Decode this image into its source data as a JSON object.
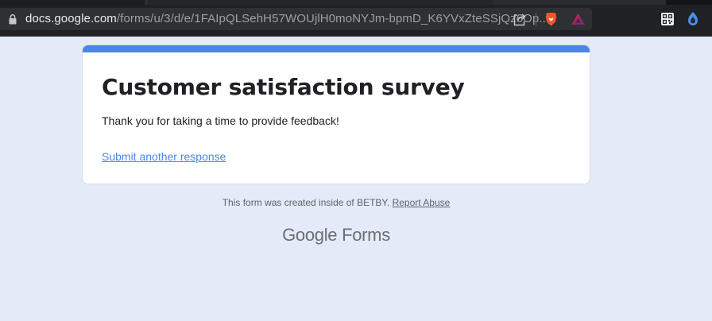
{
  "browser": {
    "url_host": "docs.google.com",
    "url_path": "/forms/u/3/d/e/1FAIpQLSehH57WOUjlH0moNYJm-bpmD_K6YVxZteSSjQz6Op..."
  },
  "form": {
    "title": "Customer satisfaction survey",
    "confirmation_message": "Thank you for taking a time to provide feedback!",
    "submit_another_label": "Submit another response",
    "accent_color": "#4a86e8",
    "background_color": "#e3ebf9"
  },
  "footer": {
    "created_text": "This form was created inside of BETBY.",
    "report_abuse_label": "Report Abuse",
    "logo_google": "Google",
    "logo_forms": "Forms"
  }
}
